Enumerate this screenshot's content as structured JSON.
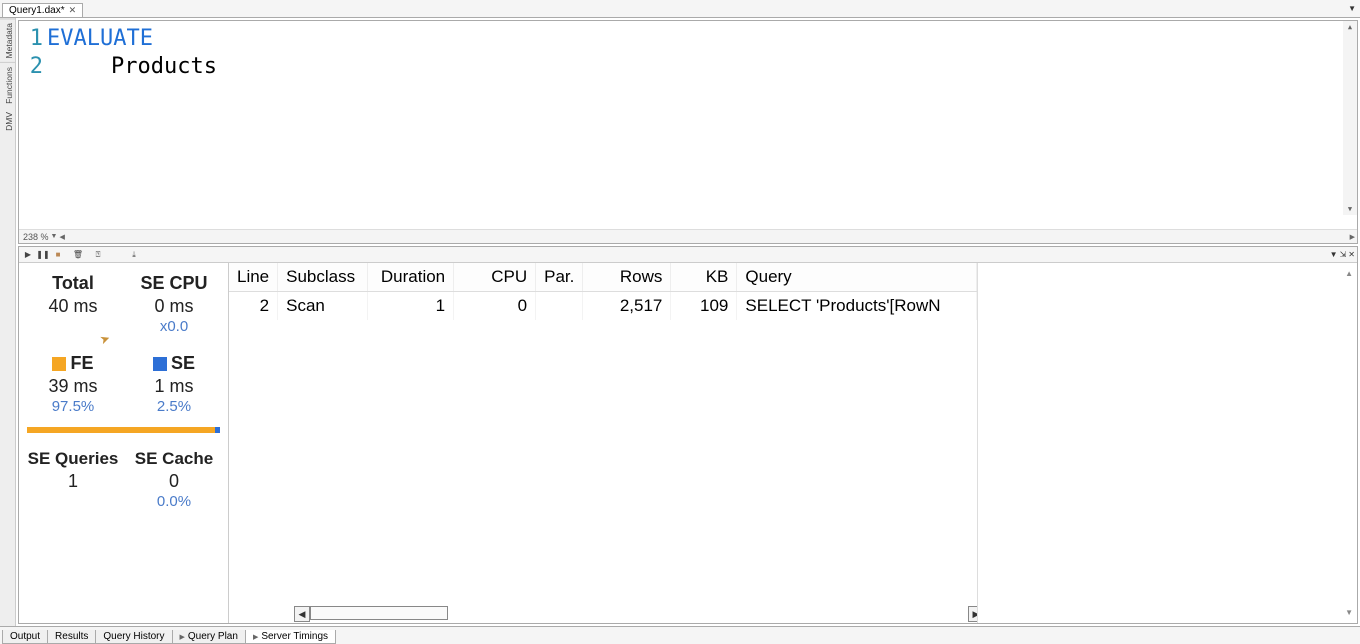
{
  "document_tab": {
    "title": "Query1.dax*"
  },
  "side_tabs": {
    "metadata": "Metadata",
    "functions": "Functions",
    "dmv": "DMV"
  },
  "editor": {
    "lines": {
      "0": "1",
      "1": "2"
    },
    "code": {
      "line1_kw": "EVALUATE",
      "line2": "Products"
    },
    "zoom": "238 %"
  },
  "toolbar": {
    "play": "▶",
    "pause": "❚❚",
    "stop": "■",
    "clear": "🗑",
    "help": "?",
    "export": "⤓",
    "dropdown": "▼",
    "pin": "⇲",
    "close": "✕"
  },
  "stats": {
    "total_label": "Total",
    "total_val": "40 ms",
    "secpu_label": "SE CPU",
    "secpu_val": "0 ms",
    "secpu_mult": "x0.0",
    "fe_label": "FE",
    "fe_val": "39 ms",
    "fe_pct": "97.5%",
    "se_label": "SE",
    "se_val": "1 ms",
    "se_pct": "2.5%",
    "seq_label": "SE Queries",
    "seq_val": "1",
    "secache_label": "SE Cache",
    "secache_val": "0",
    "secache_pct": "0.0%"
  },
  "table": {
    "headers": {
      "line": "Line",
      "subclass": "Subclass",
      "duration": "Duration",
      "cpu": "CPU",
      "par": "Par.",
      "rows": "Rows",
      "kb": "KB",
      "query": "Query"
    },
    "rows": {
      "0": {
        "line": "2",
        "subclass": "Scan",
        "duration": "1",
        "cpu": "0",
        "par": "",
        "rows": "2,517",
        "kb": "109",
        "query": "SELECT 'Products'[RowN"
      }
    }
  },
  "output_tabs": {
    "output": "Output",
    "results": "Results",
    "history": "Query History",
    "plan": "Query Plan",
    "timings": "Server Timings"
  }
}
